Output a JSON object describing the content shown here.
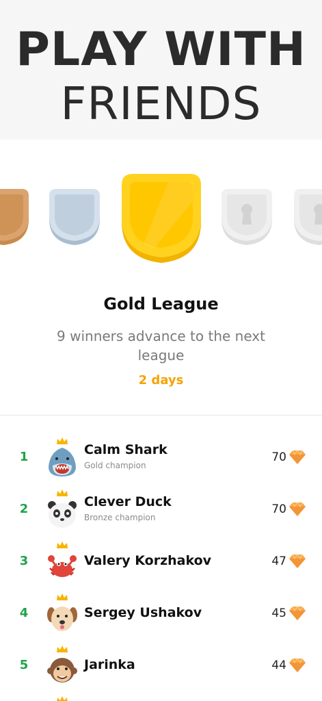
{
  "hero": {
    "line1": "PLAY WITH",
    "line2": "FRIENDS"
  },
  "badges": [
    {
      "tier": "bronze",
      "color": "#d9a066"
    },
    {
      "tier": "silver",
      "color": "#c9d7e4"
    },
    {
      "tier": "gold",
      "color": "#ffcc00"
    },
    {
      "tier": "locked",
      "color": "#ededed"
    },
    {
      "tier": "locked",
      "color": "#ededed"
    }
  ],
  "league": {
    "title": "Gold League",
    "description": "9 winners advance to the next league",
    "time_left": "2 days"
  },
  "leaderboard": [
    {
      "rank": "1",
      "name": "Calm Shark",
      "subtitle": "Gold champion",
      "score": "70",
      "avatar": "shark-icon"
    },
    {
      "rank": "2",
      "name": "Clever Duck",
      "subtitle": "Bronze champion",
      "score": "70",
      "avatar": "panda-icon"
    },
    {
      "rank": "3",
      "name": "Valery Korzhakov",
      "subtitle": "",
      "score": "47",
      "avatar": "crab-icon"
    },
    {
      "rank": "4",
      "name": "Sergey Ushakov",
      "subtitle": "",
      "score": "45",
      "avatar": "dog-icon"
    },
    {
      "rank": "5",
      "name": "Jarinka",
      "subtitle": "",
      "score": "44",
      "avatar": "monkey-icon"
    }
  ],
  "colors": {
    "accent_green": "#1fa34a",
    "accent_orange": "#f5a300",
    "gem": "#f7a84a"
  }
}
